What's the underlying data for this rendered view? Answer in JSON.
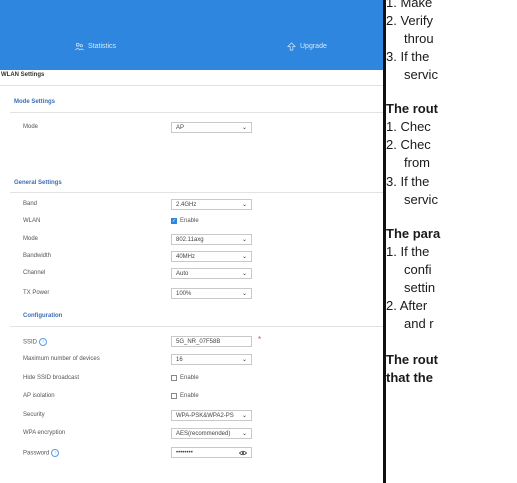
{
  "topbar": {
    "nav_statistics": "Statistics",
    "nav_upgrade": "Upgrade",
    "color": "#2e86de"
  },
  "wlan_title": "WLAN Settings",
  "mode_settings": {
    "title": "Mode Settings",
    "mode_label": "Mode",
    "mode_value": "AP"
  },
  "general_settings": {
    "title": "General Settings",
    "band_label": "Band",
    "band_value": "2.4GHz",
    "wlan_label": "WLAN",
    "wlan_enable_label": "Enable",
    "wlan_enabled": true,
    "mode_label": "Mode",
    "mode_value": "802.11axg",
    "bandwidth_label": "Bandwidth",
    "bandwidth_value": "40MHz",
    "channel_label": "Channel",
    "channel_value": "Auto",
    "txpower_label": "TX Power",
    "txpower_value": "100%"
  },
  "configuration": {
    "title": "Configuration",
    "ssid_label": "SSID",
    "ssid_value": "5G_NR_07F58B",
    "max_devices_label": "Maximum number of devices",
    "max_devices_value": "16",
    "hide_ssid_label": "Hide SSID broadcast",
    "hide_ssid_enable": "Enable",
    "ap_isolation_label": "AP isolation",
    "ap_isolation_enable": "Enable",
    "security_label": "Security",
    "security_value": "WPA-PSK&WPA2-PS",
    "wpa_label": "WPA encryption",
    "wpa_value": "AES(recommended)",
    "password_label": "Password",
    "password_value": "••••••••",
    "required_mark": "*"
  },
  "manual": {
    "l1": "1.  Make",
    "l2": "2.  Verify",
    "l3": "throu",
    "l4": "3.  If the",
    "l5": "servic",
    "h1": "The rout",
    "l6": "1.  Chec",
    "l7": "2.  Chec",
    "l8": "from",
    "l9": "3.  If the",
    "l10": "servic",
    "h2": "The para",
    "l11": "1.  If the",
    "l12": "confi",
    "l13": "settin",
    "l14": "2.  After",
    "l15": "and r",
    "h3": "The rout",
    "h4": "that the"
  }
}
